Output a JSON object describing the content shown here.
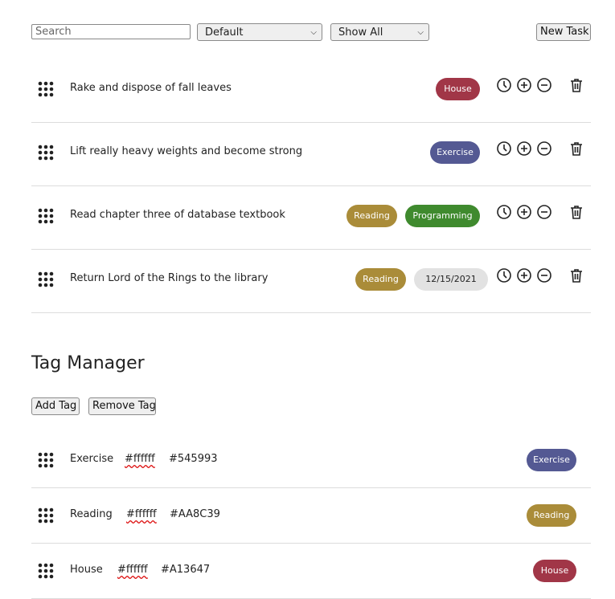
{
  "toolbar": {
    "search_placeholder": "Search",
    "sort_value": "Default",
    "filter_value": "Show All",
    "new_task_label": "New Task"
  },
  "tasks": [
    {
      "text": "Rake and dispose of fall leaves",
      "tags": [
        {
          "label": "House",
          "color": "#A13647"
        }
      ]
    },
    {
      "text": "Lift really heavy weights and become strong",
      "tags": [
        {
          "label": "Exercise",
          "color": "#545993"
        }
      ]
    },
    {
      "text": "Read chapter three of database textbook",
      "tags": [
        {
          "label": "Reading",
          "color": "#AA8C39"
        },
        {
          "label": "Programming",
          "color": "#3F8A2E"
        }
      ]
    },
    {
      "text": "Return Lord of the Rings to the library",
      "tags": [
        {
          "label": "Reading",
          "color": "#AA8C39"
        }
      ],
      "due_date": "12/15/2021"
    }
  ],
  "icons": [
    "clock-icon",
    "plus-circle-icon",
    "minus-circle-icon",
    "trash-icon",
    "drag-grip-icon"
  ],
  "tag_manager": {
    "title": "Tag Manager",
    "add_tag_label": "Add Tag",
    "remove_tag_label": "Remove Tag",
    "tags": [
      {
        "name": "Exercise",
        "text_color": "#ffffff",
        "bg_color": "#545993",
        "badge": "Exercise"
      },
      {
        "name": "Reading",
        "text_color": "#ffffff",
        "bg_color": "#AA8C39",
        "badge": "Reading"
      },
      {
        "name": "House",
        "text_color": "#ffffff",
        "bg_color": "#A13647",
        "badge": "House"
      }
    ]
  }
}
